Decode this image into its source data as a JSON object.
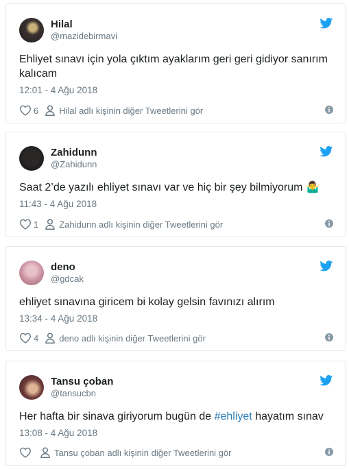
{
  "tweets": [
    {
      "name": "Hilal",
      "handle": "@mazidebirmavi",
      "text": "Ehliyet sınavı için yola çıktım ayaklarım geri geri gidiyor sanırım kalıcam",
      "time": "12:01 - 4 Ağu 2018",
      "likes": "6",
      "profile_link": "Hilal adlı kişinin diğer Tweetlerini gör"
    },
    {
      "name": "Zahidunn",
      "handle": "@Zahidunn",
      "text": "Saat 2’de yazılı ehliyet sınavı var ve hiç bir şey bilmiyorum",
      "emoji": "🤷‍♂️",
      "time": "11:43 - 4 Ağu 2018",
      "likes": "1",
      "profile_link": "Zahidunn adlı kişinin diğer Tweetlerini gör"
    },
    {
      "name": "deno",
      "handle": "@gdcak",
      "text": "ehliyet sınavına giricem bi kolay gelsin favınızı alırım",
      "time": "13:34 - 4 Ağu 2018",
      "likes": "4",
      "profile_link": "deno adlı kişinin diğer Tweetlerini gör"
    },
    {
      "name": "Tansu çoban",
      "handle": "@tansucbn",
      "text_before": "Her hafta bir sinava giriyorum bugün de ",
      "hashtag": "#ehliyet",
      "text_after": " hayatım sınav",
      "time": "13:08 - 4 Ağu 2018",
      "likes": "",
      "profile_link": "Tansu çoban adlı kişinin diğer Tweetlerini gör"
    }
  ],
  "icons": {
    "brand": "twitter-bird-icon",
    "like": "heart-icon",
    "profile": "person-icon",
    "info": "info-icon"
  },
  "colors": {
    "twitter_blue": "#1da1f2",
    "hashtag": "#2b7bb9",
    "meta_gray": "#697882",
    "border": "#e1e8ed"
  }
}
